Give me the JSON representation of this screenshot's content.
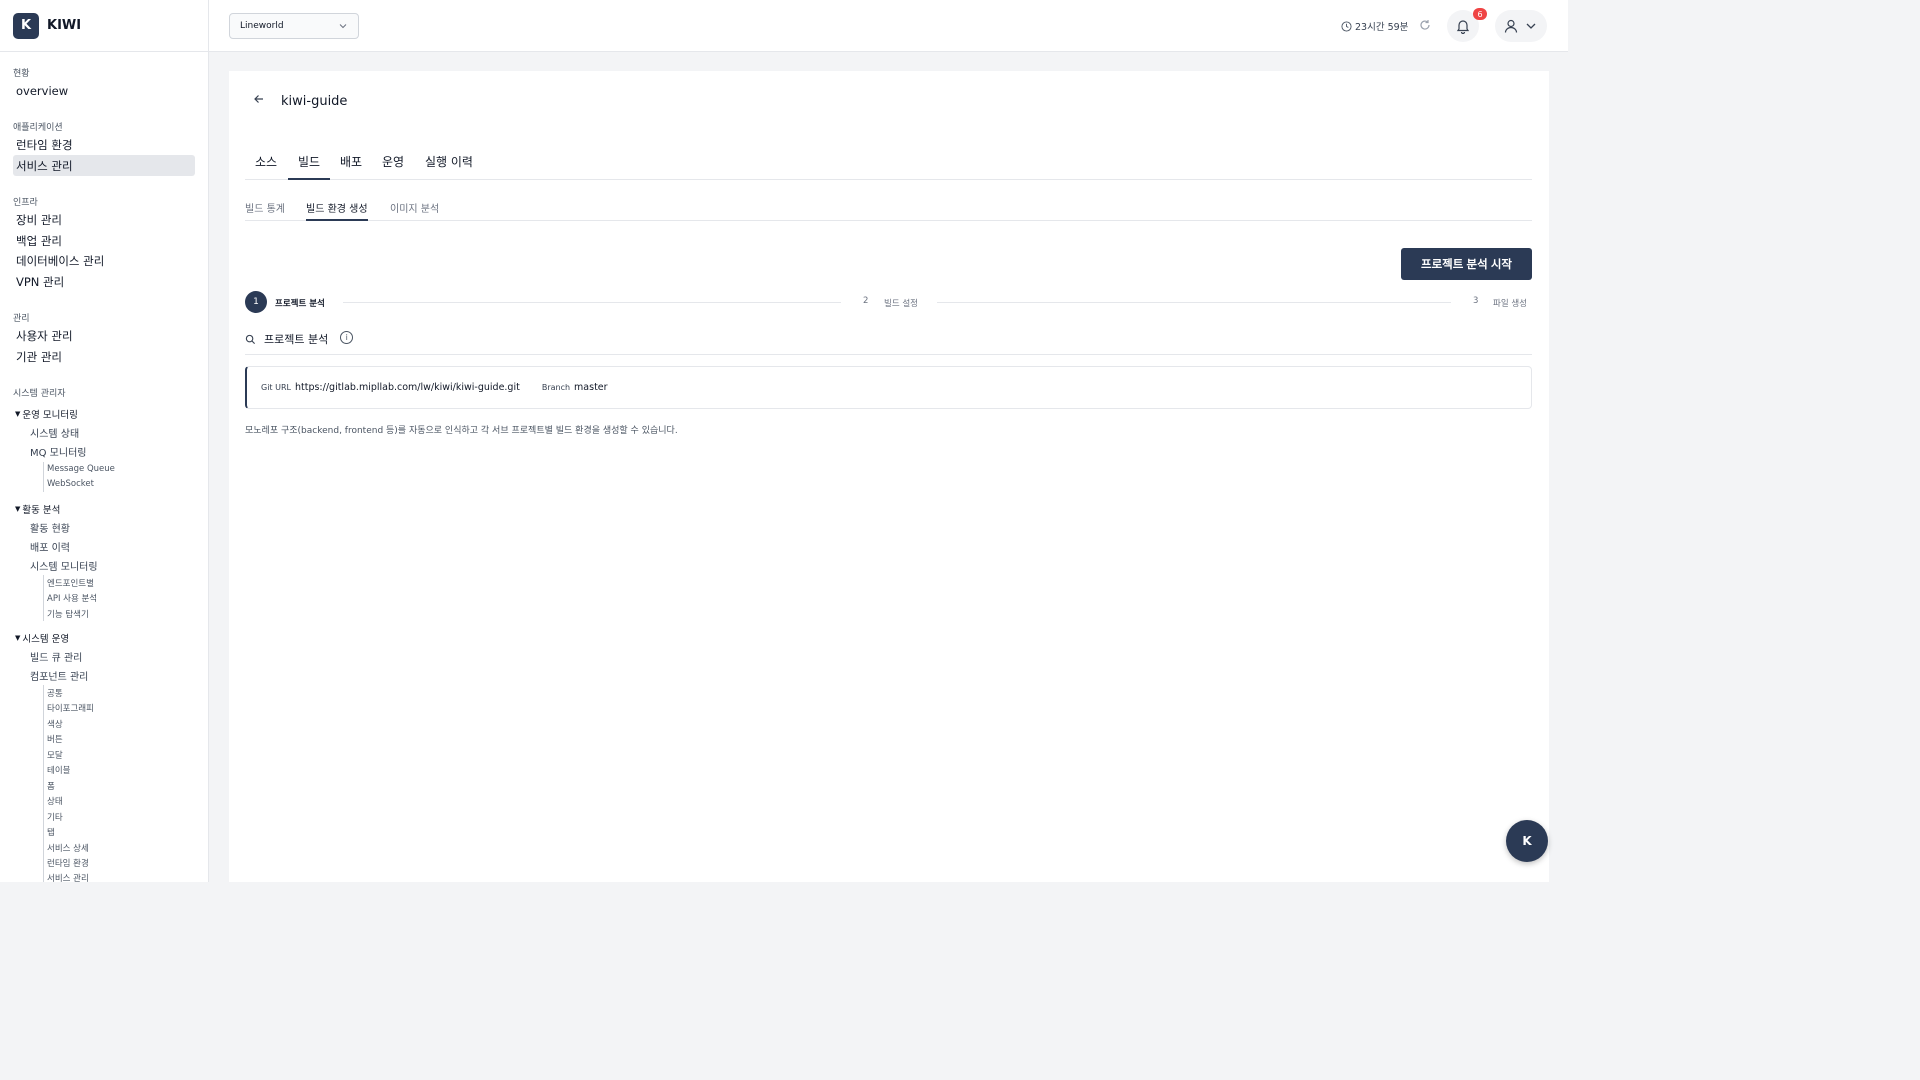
{
  "brand": {
    "logo": "K",
    "name": "KIWI"
  },
  "header": {
    "workspace": "Lineworld",
    "session": "23시간 59분",
    "notif_count": "6"
  },
  "sidebar": {
    "s1": "현황",
    "overview": "overview",
    "s2": "애플리케이션",
    "runtime": "런타임 환경",
    "service": "서비스 관리",
    "s3": "인프라",
    "equip": "장비 관리",
    "backup": "백업 관리",
    "db": "데이터베이스 관리",
    "vpn": "VPN 관리",
    "s4": "관리",
    "users": "사용자 관리",
    "orgs": "기관 관리",
    "s5": "시스템 관리자",
    "g1": "운영 모니터링",
    "sys_status": "시스템 상태",
    "mq": "MQ 모니터링",
    "mq_queue": "Message Queue",
    "ws": "WebSocket",
    "g2": "활동 분석",
    "activity": "활동 현황",
    "deploy_hist": "배포 이력",
    "sys_mon": "시스템 모니터링",
    "endpoint": "엔드포인트별",
    "api_usage": "API 사용 분석",
    "feature": "기능 탐색기",
    "g3": "시스템 운영",
    "build_queue": "빌드 큐 관리",
    "components": "컴포넌트 관리",
    "c_common": "공통",
    "c_typo": "타이포그래피",
    "c_color": "색상",
    "c_button": "버튼",
    "c_modal": "모달",
    "c_table": "테이블",
    "c_form": "폼",
    "c_status": "상태",
    "c_etc": "기타",
    "c_tab": "탭",
    "c_svc_detail": "서비스 상세",
    "c_runtime": "런타임 환경",
    "c_svc_mgmt": "서비스 관리"
  },
  "page": {
    "title": "kiwi-guide"
  },
  "tabs": {
    "source": "소스",
    "build": "빌드",
    "deploy": "배포",
    "ops": "운영",
    "history": "실행 이력"
  },
  "subtabs": {
    "stats": "빌드 통계",
    "env": "빌드 환경 생성",
    "image": "이미지 분석"
  },
  "actions": {
    "start": "프로젝트 분석 시작"
  },
  "steps": {
    "s1_num": "1",
    "s1": "프로젝트 분석",
    "s2_num": "2",
    "s2": "빌드 설정",
    "s3_num": "3",
    "s3": "파일 생성"
  },
  "section": {
    "title": "프로젝트 분석",
    "info": "i"
  },
  "repo": {
    "git_label": "Git URL",
    "git_url": "https://gitlab.mipllab.com/lw/kiwi/kiwi-guide.git",
    "branch_label": "Branch",
    "branch": "master"
  },
  "hint": "모노레포 구조(backend, frontend 등)를 자동으로 인식하고 각 서브 프로젝트별 빌드 환경을 생성할 수 있습니다.",
  "fab": "K"
}
